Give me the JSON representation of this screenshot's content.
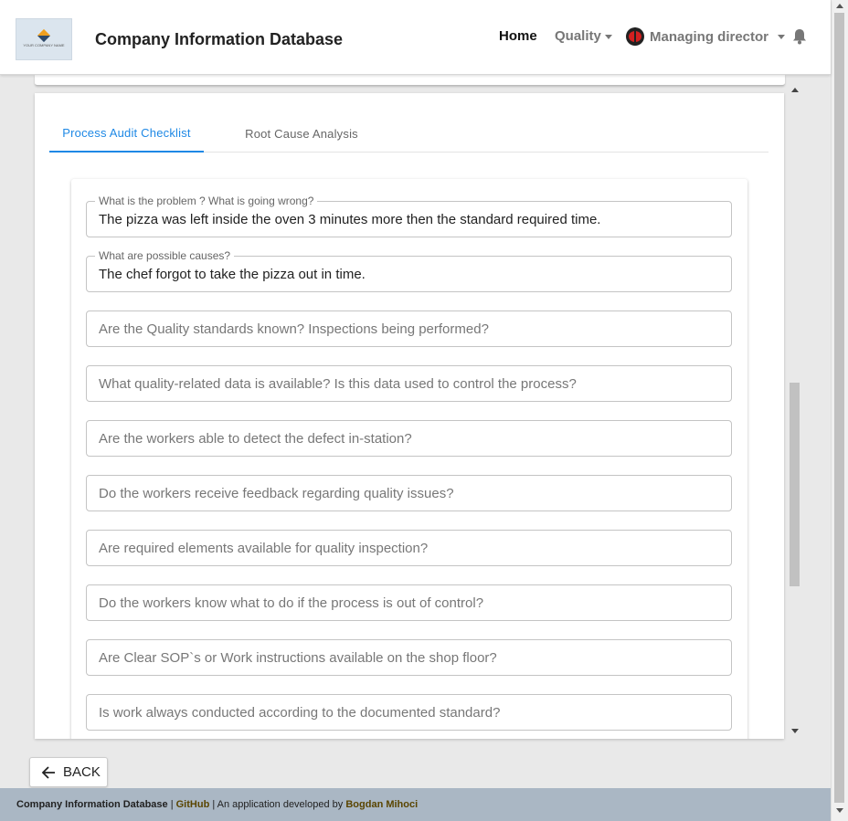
{
  "header": {
    "logo_text": "YOUR COMPANY NAME",
    "app_title": "Company Information Database",
    "nav": {
      "home": "Home",
      "quality": "Quality",
      "user": "Managing director"
    }
  },
  "tabs": [
    {
      "label": "Process Audit Checklist",
      "active": true
    },
    {
      "label": "Root Cause Analysis",
      "active": false
    }
  ],
  "form": {
    "problem": {
      "label": "What is the problem ? What is going wrong?",
      "value": "The pizza was left inside the oven 3 minutes more then the standard required time."
    },
    "causes": {
      "label": "What are possible causes?",
      "value": "The chef forgot to take the pizza out in time."
    },
    "questions": [
      "Are the Quality standards known? Inspections being performed?",
      "What quality-related data is available? Is this data used to control the process?",
      "Are the workers able to detect the defect in-station?",
      "Do the workers receive feedback regarding quality issues?",
      "Are required elements available for quality inspection?",
      "Do the workers know what to do if the process is out of control?",
      "Are Clear SOP`s or Work instructions available on the shop floor?",
      "Is work always conducted according to the documented standard?"
    ]
  },
  "back_button": {
    "label": "BACK",
    "icon": "arrow-left-icon"
  },
  "footer": {
    "app_name": "Company Information Database",
    "sep": "|",
    "github": "GitHub",
    "developed_by": "| An application developed by",
    "author": "Bogdan Mihoci"
  },
  "colors": {
    "accent": "#1e88e5",
    "footer_bg": "#aab7c4",
    "footer_link": "#5a4500"
  }
}
